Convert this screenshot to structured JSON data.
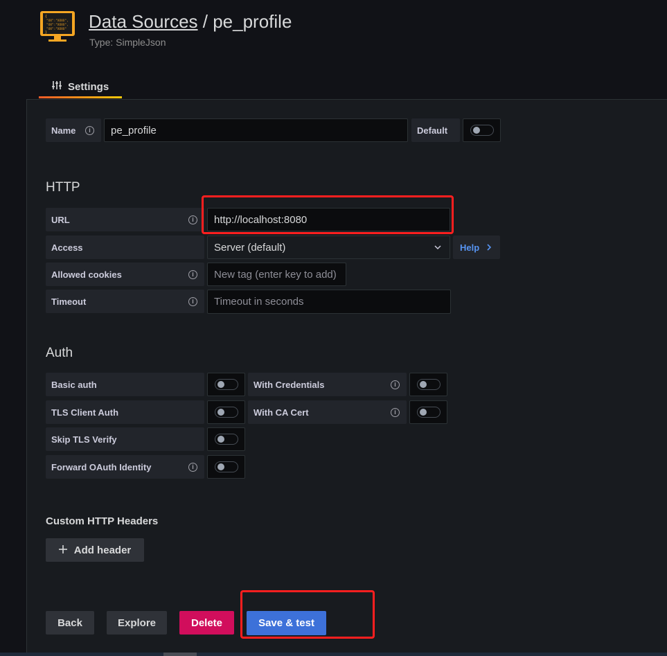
{
  "header": {
    "breadcrumb_link": "Data Sources",
    "separator": " / ",
    "title": "pe_profile",
    "subtitle": "Type: SimpleJson",
    "logo_lines": [
      "{",
      "\"XX\":\"XXXX\",",
      "\"XX\":\"XXXX\",",
      "\"XX\":\"XXXX\"",
      "}"
    ]
  },
  "tabs": [
    {
      "label": "Settings",
      "icon": "sliders-icon"
    }
  ],
  "general": {
    "name_label": "Name",
    "name_value": "pe_profile",
    "default_label": "Default"
  },
  "http": {
    "section_title": "HTTP",
    "url_label": "URL",
    "url_value": "http://localhost:8080",
    "access_label": "Access",
    "access_value": "Server (default)",
    "help_label": "Help",
    "cookies_label": "Allowed cookies",
    "cookies_placeholder": "New tag (enter key to add)",
    "timeout_label": "Timeout",
    "timeout_placeholder": "Timeout in seconds"
  },
  "auth": {
    "section_title": "Auth",
    "basic_auth": "Basic auth",
    "with_credentials": "With Credentials",
    "tls_client_auth": "TLS Client Auth",
    "with_ca_cert": "With CA Cert",
    "skip_tls_verify": "Skip TLS Verify",
    "forward_oauth": "Forward OAuth Identity"
  },
  "headers": {
    "section_title": "Custom HTTP Headers",
    "add_label": "Add header"
  },
  "actions": {
    "back": "Back",
    "explore": "Explore",
    "delete": "Delete",
    "save_test": "Save & test"
  },
  "colors": {
    "background": "#111217",
    "panel": "#181b1f",
    "primary": "#3d71d9",
    "danger": "#d10e5c",
    "highlight": "#ff1f1f",
    "logo_orange": "#f5a623"
  }
}
